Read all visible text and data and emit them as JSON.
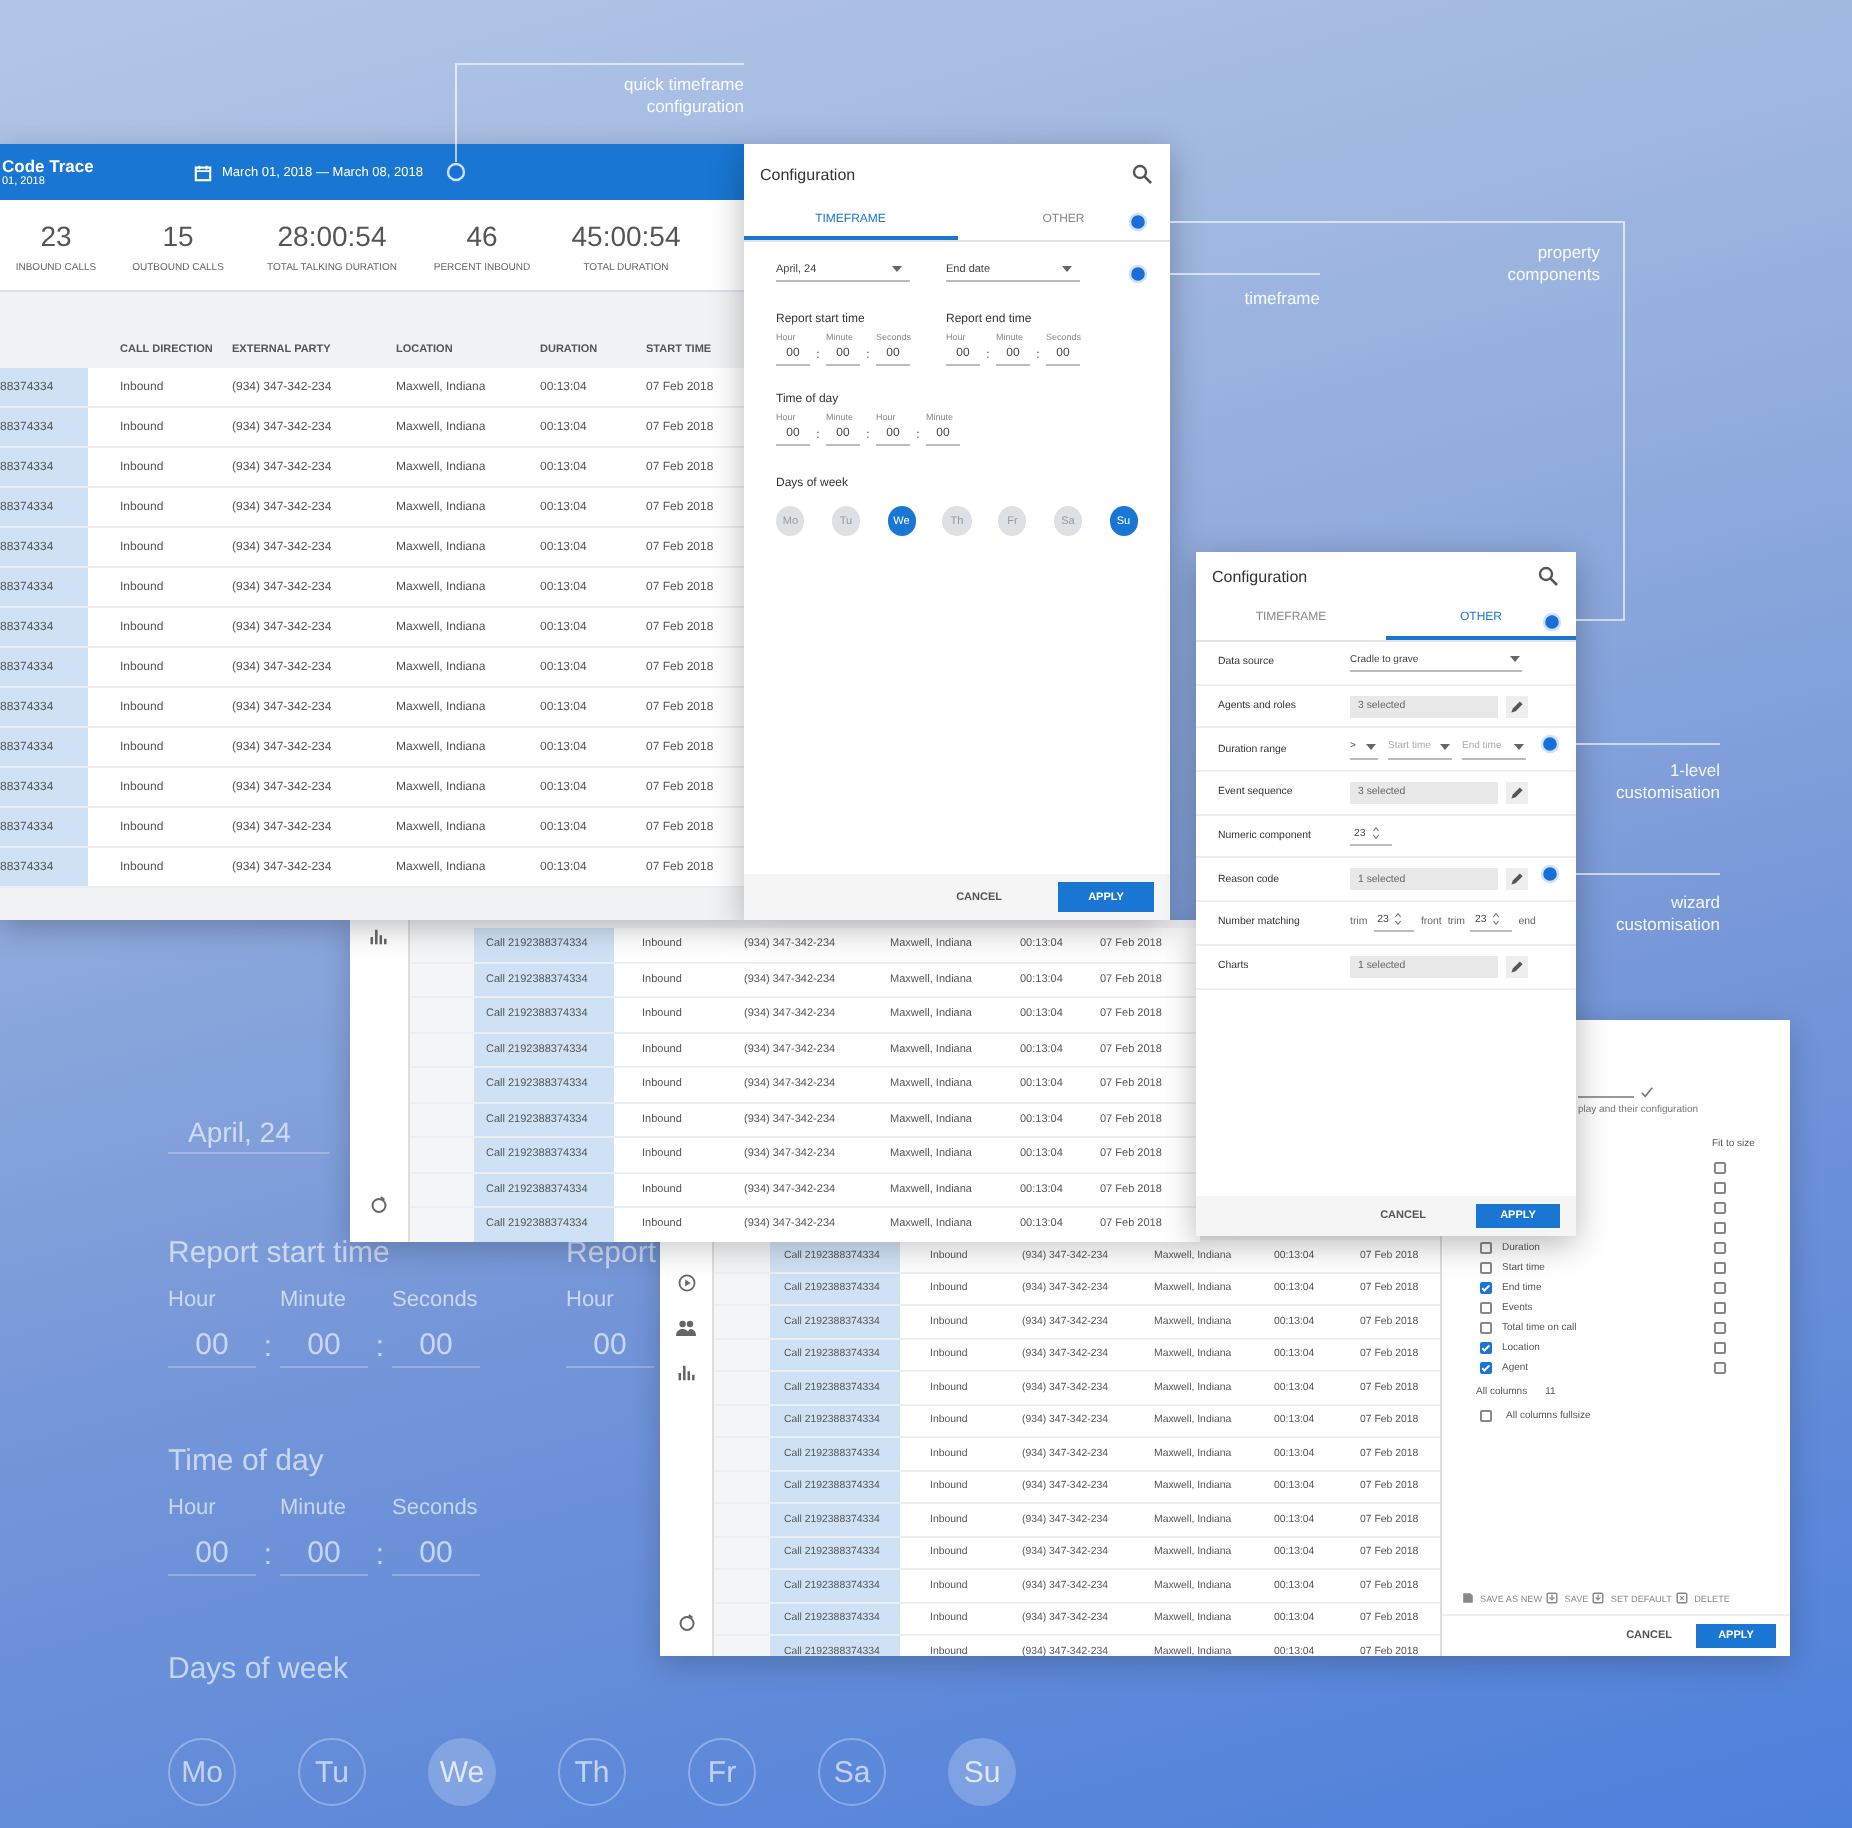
{
  "backdrop": {
    "date": "April, 24",
    "report_start": {
      "label": "Report start time",
      "fields": [
        {
          "unit": "Hour",
          "value": "00"
        },
        {
          "unit": "Minute",
          "value": "00"
        },
        {
          "unit": "Seconds",
          "value": "00"
        }
      ]
    },
    "report_end": {
      "label": "Report",
      "fields": [
        {
          "unit": "Hour",
          "value": "00"
        }
      ]
    },
    "time_of_day": {
      "label": "Time of day",
      "fields": [
        {
          "unit": "Hour",
          "value": "00"
        },
        {
          "unit": "Minute",
          "value": "00"
        },
        {
          "unit": "Seconds",
          "value": "00"
        }
      ]
    },
    "separator": ":",
    "days_label": "Days of week",
    "days": [
      {
        "label": "Mo",
        "selected": false
      },
      {
        "label": "Tu",
        "selected": false
      },
      {
        "label": "We",
        "selected": true
      },
      {
        "label": "Th",
        "selected": false
      },
      {
        "label": "Fr",
        "selected": false
      },
      {
        "label": "Sa",
        "selected": false
      },
      {
        "label": "Su",
        "selected": true
      }
    ]
  },
  "window_three": {
    "rows": [
      {
        "call": "Call 2192388374334",
        "direction": "Inbound",
        "party": "(934) 347-342-234",
        "location": "Maxwell, Indiana",
        "duration": "00:13:04",
        "start": "07 Feb 2018"
      },
      {
        "call": "Call 2192388374334",
        "direction": "Inbound",
        "party": "(934) 347-342-234",
        "location": "Maxwell, Indiana",
        "duration": "00:13:04",
        "start": "07 Feb 2018"
      },
      {
        "call": "Call 2192388374334",
        "direction": "Inbound",
        "party": "(934) 347-342-234",
        "location": "Maxwell, Indiana",
        "duration": "00:13:04",
        "start": "07 Feb 2018"
      },
      {
        "call": "Call 2192388374334",
        "direction": "Inbound",
        "party": "(934) 347-342-234",
        "location": "Maxwell, Indiana",
        "duration": "00:13:04",
        "start": "07 Feb 2018"
      },
      {
        "call": "Call 2192388374334",
        "direction": "Inbound",
        "party": "(934) 347-342-234",
        "location": "Maxwell, Indiana",
        "duration": "00:13:04",
        "start": "07 Feb 2018"
      },
      {
        "call": "Call 2192388374334",
        "direction": "Inbound",
        "party": "(934) 347-342-234",
        "location": "Maxwell, Indiana",
        "duration": "00:13:04",
        "start": "07 Feb 2018"
      },
      {
        "call": "Call 2192388374334",
        "direction": "Inbound",
        "party": "(934) 347-342-234",
        "location": "Maxwell, Indiana",
        "duration": "00:13:04",
        "start": "07 Feb 2018"
      },
      {
        "call": "Call 2192388374334",
        "direction": "Inbound",
        "party": "(934) 347-342-234",
        "location": "Maxwell, Indiana",
        "duration": "00:13:04",
        "start": "07 Feb 2018"
      },
      {
        "call": "Call 2192388374334",
        "direction": "Inbound",
        "party": "(934) 347-342-234",
        "location": "Maxwell, Indiana",
        "duration": "00:13:04",
        "start": "07 Feb 2018"
      },
      {
        "call": "Call 2192388374334",
        "direction": "Inbound",
        "party": "(934) 347-342-234",
        "location": "Maxwell, Indiana",
        "duration": "00:13:04",
        "start": "07 Feb 2018"
      },
      {
        "call": "Call 2192388374334",
        "direction": "Inbound",
        "party": "(934) 347-342-234",
        "location": "Maxwell, Indiana",
        "duration": "00:13:04",
        "start": "07 Feb 2018"
      },
      {
        "call": "Call 2192388374334",
        "direction": "Inbound",
        "party": "(934) 347-342-234",
        "location": "Maxwell, Indiana",
        "duration": "00:13:04",
        "start": "07 Feb 2018"
      },
      {
        "call": "Call 2192388374334",
        "direction": "Inbound",
        "party": "(934) 347-342-234",
        "location": "Maxwell, Indiana",
        "duration": "00:13:04",
        "start": "07 Feb 2018"
      }
    ],
    "panel": {
      "hint": "play and their configuration",
      "fit_label": "Fit to size",
      "columns": [
        {
          "label": "Duration",
          "checked": false
        },
        {
          "label": "Start time",
          "checked": false
        },
        {
          "label": "End time",
          "checked": true
        },
        {
          "label": "Events",
          "checked": false
        },
        {
          "label": "Total time on call",
          "checked": false
        },
        {
          "label": "Location",
          "checked": true
        },
        {
          "label": "Agent",
          "checked": true
        }
      ],
      "fit": [
        {
          "checked": false
        },
        {
          "checked": false
        },
        {
          "checked": false
        },
        {
          "checked": false
        },
        {
          "checked": false
        },
        {
          "checked": false
        },
        {
          "checked": false
        },
        {
          "checked": false
        },
        {
          "checked": false
        },
        {
          "checked": false
        },
        {
          "checked": false
        }
      ],
      "all_columns_label": "All columns",
      "all_columns_count": "11",
      "fullsize": {
        "label": "All columns fullsize",
        "checked": false
      },
      "actions": [
        {
          "kind": "save_as_new",
          "label": "SAVE AS NEW"
        },
        {
          "kind": "save",
          "label": "SAVE"
        },
        {
          "kind": "set_default",
          "label": "SET DEFAULT"
        },
        {
          "kind": "delete",
          "label": "DELETE"
        }
      ],
      "cancel": "CANCEL",
      "apply": "APPLY"
    }
  },
  "window_two": {
    "rows": [
      {
        "call": "Call 2192388374334",
        "direction": "Inbound",
        "party": "(934) 347-342-234",
        "location": "Maxwell, Indiana",
        "duration": "00:13:04",
        "start": "07 Feb 2018"
      },
      {
        "call": "Call 2192388374334",
        "direction": "Inbound",
        "party": "(934) 347-342-234",
        "location": "Maxwell, Indiana",
        "duration": "00:13:04",
        "start": "07 Feb 2018"
      },
      {
        "call": "Call 2192388374334",
        "direction": "Inbound",
        "party": "(934) 347-342-234",
        "location": "Maxwell, Indiana",
        "duration": "00:13:04",
        "start": "07 Feb 2018"
      },
      {
        "call": "Call 2192388374334",
        "direction": "Inbound",
        "party": "(934) 347-342-234",
        "location": "Maxwell, Indiana",
        "duration": "00:13:04",
        "start": "07 Feb 2018"
      },
      {
        "call": "Call 2192388374334",
        "direction": "Inbound",
        "party": "(934) 347-342-234",
        "location": "Maxwell, Indiana",
        "duration": "00:13:04",
        "start": "07 Feb 2018"
      },
      {
        "call": "Call 2192388374334",
        "direction": "Inbound",
        "party": "(934) 347-342-234",
        "location": "Maxwell, Indiana",
        "duration": "00:13:04",
        "start": "07 Feb 2018"
      },
      {
        "call": "Call 2192388374334",
        "direction": "Inbound",
        "party": "(934) 347-342-234",
        "location": "Maxwell, Indiana",
        "duration": "00:13:04",
        "start": "07 Feb 2018"
      },
      {
        "call": "Call 2192388374334",
        "direction": "Inbound",
        "party": "(934) 347-342-234",
        "location": "Maxwell, Indiana",
        "duration": "00:13:04",
        "start": "07 Feb 2018"
      },
      {
        "call": "Call 2192388374334",
        "direction": "Inbound",
        "party": "(934) 347-342-234",
        "location": "Maxwell, Indiana",
        "duration": "00:13:04",
        "start": "07 Feb 2018"
      }
    ]
  },
  "window_one": {
    "title": "Code Trace",
    "subtitle": "01, 2018",
    "date_range": "March 01, 2018 — March 08, 2018",
    "stats": [
      {
        "value": "23",
        "label": "INBOUND CALLS"
      },
      {
        "value": "15",
        "label": "OUTBOUND CALLS"
      },
      {
        "value": "28:00:54",
        "label": "TOTAL TALKING DURATION"
      },
      {
        "value": "46",
        "label": "PERCENT INBOUND"
      },
      {
        "value": "45:00:54",
        "label": "TOTAL DURATION"
      }
    ],
    "columns": [
      "CALL DIRECTION",
      "EXTERNAL PARTY",
      "LOCATION",
      "DURATION",
      "START TIME"
    ],
    "rows": [
      {
        "call": "88374334",
        "direction": "Inbound",
        "party": "(934) 347-342-234",
        "location": "Maxwell, Indiana",
        "duration": "00:13:04",
        "start": "07 Feb 2018"
      },
      {
        "call": "88374334",
        "direction": "Inbound",
        "party": "(934) 347-342-234",
        "location": "Maxwell, Indiana",
        "duration": "00:13:04",
        "start": "07 Feb 2018"
      },
      {
        "call": "88374334",
        "direction": "Inbound",
        "party": "(934) 347-342-234",
        "location": "Maxwell, Indiana",
        "duration": "00:13:04",
        "start": "07 Feb 2018"
      },
      {
        "call": "88374334",
        "direction": "Inbound",
        "party": "(934) 347-342-234",
        "location": "Maxwell, Indiana",
        "duration": "00:13:04",
        "start": "07 Feb 2018"
      },
      {
        "call": "88374334",
        "direction": "Inbound",
        "party": "(934) 347-342-234",
        "location": "Maxwell, Indiana",
        "duration": "00:13:04",
        "start": "07 Feb 2018"
      },
      {
        "call": "88374334",
        "direction": "Inbound",
        "party": "(934) 347-342-234",
        "location": "Maxwell, Indiana",
        "duration": "00:13:04",
        "start": "07 Feb 2018"
      },
      {
        "call": "88374334",
        "direction": "Inbound",
        "party": "(934) 347-342-234",
        "location": "Maxwell, Indiana",
        "duration": "00:13:04",
        "start": "07 Feb 2018"
      },
      {
        "call": "88374334",
        "direction": "Inbound",
        "party": "(934) 347-342-234",
        "location": "Maxwell, Indiana",
        "duration": "00:13:04",
        "start": "07 Feb 2018"
      },
      {
        "call": "88374334",
        "direction": "Inbound",
        "party": "(934) 347-342-234",
        "location": "Maxwell, Indiana",
        "duration": "00:13:04",
        "start": "07 Feb 2018"
      },
      {
        "call": "88374334",
        "direction": "Inbound",
        "party": "(934) 347-342-234",
        "location": "Maxwell, Indiana",
        "duration": "00:13:04",
        "start": "07 Feb 2018"
      },
      {
        "call": "88374334",
        "direction": "Inbound",
        "party": "(934) 347-342-234",
        "location": "Maxwell, Indiana",
        "duration": "00:13:04",
        "start": "07 Feb 2018"
      },
      {
        "call": "88374334",
        "direction": "Inbound",
        "party": "(934) 347-342-234",
        "location": "Maxwell, Indiana",
        "duration": "00:13:04",
        "start": "07 Feb 2018"
      },
      {
        "call": "88374334",
        "direction": "Inbound",
        "party": "(934) 347-342-234",
        "location": "Maxwell, Indiana",
        "duration": "00:13:04",
        "start": "07 Feb 2018"
      }
    ]
  },
  "config_timeframe": {
    "title": "Configuration",
    "tabs": [
      {
        "label": "TIMEFRAME",
        "selected": true
      },
      {
        "label": "OTHER",
        "selected": false
      }
    ],
    "start_date": "April, 24",
    "end_date": "End date",
    "report_start": {
      "label": "Report start time",
      "fields": [
        {
          "unit": "Hour",
          "value": "00"
        },
        {
          "unit": "Minute",
          "value": "00"
        },
        {
          "unit": "Seconds",
          "value": "00"
        }
      ]
    },
    "report_end": {
      "label": "Report end time",
      "fields": [
        {
          "unit": "Hour",
          "value": "00"
        },
        {
          "unit": "Minute",
          "value": "00"
        },
        {
          "unit": "Seconds",
          "value": "00"
        }
      ]
    },
    "time_of_day": {
      "label": "Time of day",
      "fields": [
        {
          "unit": "Hour",
          "value": "00"
        },
        {
          "unit": "Minute",
          "value": "00"
        },
        {
          "unit": "Hour",
          "value": "00"
        },
        {
          "unit": "Minute",
          "value": "00"
        }
      ]
    },
    "separator": ":",
    "days_label": "Days of week",
    "days": [
      {
        "label": "Mo",
        "selected": false
      },
      {
        "label": "Tu",
        "selected": false
      },
      {
        "label": "We",
        "selected": true
      },
      {
        "label": "Th",
        "selected": false
      },
      {
        "label": "Fr",
        "selected": false
      },
      {
        "label": "Sa",
        "selected": false
      },
      {
        "label": "Su",
        "selected": true
      }
    ],
    "cancel": "CANCEL",
    "apply": "APPLY"
  },
  "config_other": {
    "title": "Configuration",
    "tabs": [
      {
        "label": "TIMEFRAME",
        "selected": false
      },
      {
        "label": "OTHER",
        "selected": true
      }
    ],
    "rows": [
      {
        "kind": "dropdown",
        "label": "Data source",
        "value": "Cradle to grave"
      },
      {
        "kind": "picker",
        "label": "Agents and roles",
        "value": "3 selected"
      },
      {
        "kind": "range",
        "label": "Duration range",
        "operator": ">",
        "start_placeholder": "Start time",
        "end_placeholder": "End time"
      },
      {
        "kind": "picker",
        "label": "Event sequence",
        "value": "3 selected"
      },
      {
        "kind": "number",
        "label": "Numeric component",
        "value": "23"
      },
      {
        "kind": "picker",
        "label": "Reason code",
        "value": "1 selected"
      },
      {
        "kind": "matching",
        "label": "Number matching",
        "front_prefix": "trim",
        "front_value": "23",
        "front_suffix": "front",
        "end_prefix": "trim",
        "end_value": "23",
        "end_suffix": "end"
      },
      {
        "kind": "picker",
        "label": "Charts",
        "value": "1 selected"
      }
    ],
    "cancel": "CANCEL",
    "apply": "APPLY"
  },
  "annotations": [
    {
      "text": "quick timeframe configuration"
    },
    {
      "text": "property components"
    },
    {
      "text": "timeframe"
    },
    {
      "text": "1-level customisation"
    },
    {
      "text": "wizard customisation"
    }
  ]
}
